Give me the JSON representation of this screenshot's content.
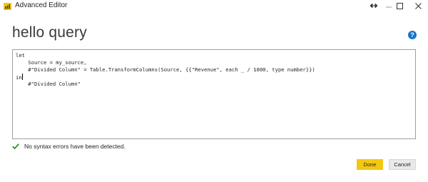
{
  "window": {
    "title": "Advanced Editor",
    "resize_icon": "double-arrow-icon",
    "minimize_icon": "minimize-icon",
    "maximize_icon": "maximize-icon",
    "close_icon": "close-icon"
  },
  "query": {
    "name": "hello query",
    "help_label": "?"
  },
  "editor": {
    "lines": [
      "let",
      "    Source = my_source,",
      "    #\"Divided Column\" = Table.TransformColumns(Source, {{\"Revenue\", each _ / 1000, type number}})",
      "in",
      "    #\"Divided Column\""
    ]
  },
  "status": {
    "icon": "checkmark-icon",
    "message": "No syntax errors have been detected."
  },
  "buttons": {
    "done_label": "Done",
    "cancel_label": "Cancel"
  },
  "colors": {
    "accent_yellow": "#f2c811",
    "check_green": "#107c10",
    "help_blue": "#1a73c8"
  }
}
